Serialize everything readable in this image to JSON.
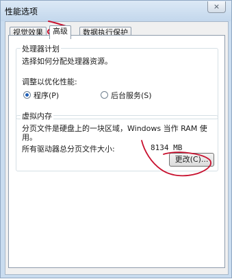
{
  "window": {
    "title": "性能选项",
    "close_glyph": "×"
  },
  "tabs": [
    {
      "label": "视觉效果"
    },
    {
      "label": "高级"
    },
    {
      "label": "数据执行保护"
    }
  ],
  "processor_group": {
    "title": "处理器计划",
    "description": "选择如何分配处理器资源。",
    "adjust_label": "调整以优化性能:",
    "options": [
      {
        "label": "程序(P)",
        "selected": true
      },
      {
        "label": "后台服务(S)",
        "selected": false
      }
    ]
  },
  "virtual_memory_group": {
    "title": "虚拟内存",
    "description_line1": "分页文件是硬盘上的一块区域，Windows 当作 RAM 使",
    "description_line2": "用。",
    "total_label": "所有驱动器总分页文件大小:",
    "total_value": "8134 MB",
    "change_button": "更改(C)..."
  },
  "annotation_color": "#c8102e"
}
